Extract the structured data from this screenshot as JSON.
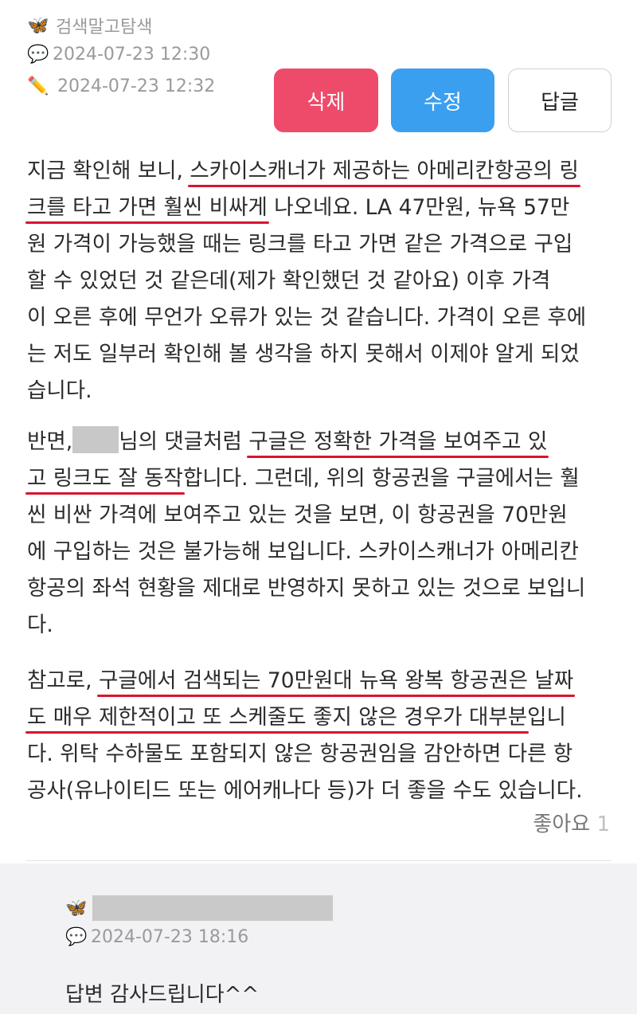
{
  "post": {
    "author_icon": "butterfly-icon",
    "author": "검색말고탐색",
    "created_icon": "speech-bubble-icon",
    "created": "2024-07-23 12:30",
    "edited_icon": "pencil-icon",
    "edited": "2024-07-23 12:32"
  },
  "actions": {
    "delete": "삭제",
    "edit": "수정",
    "reply": "답글"
  },
  "colors": {
    "delete_bg": "#ee4b6a",
    "edit_bg": "#3b9ff0",
    "underline": "#d8152d"
  },
  "body": {
    "p1_l1_a": "지금 확인해 보니, ",
    "p1_l1_b": "스카이스캐너가 제공하는 아메리칸항공의 링",
    "p1_l2_a": "크를 타고 가면 훨씬 비싸게",
    "p1_l2_b": " 나오네요. LA 47만원, 뉴욕 57만",
    "p1_l3": "원 가격이 가능했을 때는 링크를 타고 가면 같은 가격으로 구입",
    "p1_l4": "할 수 있었던 것 같은데(제가 확인했던 것 같아요) 이후 가격",
    "p1_l5": "이 오른 후에 무언가 오류가 있는 것 같습니다. 가격이 오른 후에",
    "p1_l6": "는 저도 일부러 확인해 볼 생각을 하지 못해서 이제야 알게 되었",
    "p1_l7": "습니다.",
    "p2_l1_a": "반면,",
    "p2_l1_b": "님의 댓글처럼 ",
    "p2_l1_c": "구글은 정확한 가격을 보여주고 있",
    "p2_l2_a": "고 링크도 잘 동작",
    "p2_l2_b": "합니다. 그런데, 위의 항공권을 구글에서는 훨",
    "p2_l3": "씬 비싼 가격에 보여주고 있는 것을 보면, 이 항공권을 70만원",
    "p2_l4": "에 구입하는 것은 불가능해 보입니다. 스카이스캐너가 아메리칸",
    "p2_l5": "항공의 좌석 현황을 제대로 반영하지 못하고 있는 것으로 보입니",
    "p2_l6": "다.",
    "p3_l1_a": "참고로, ",
    "p3_l1_b": "구글에서 검색되는 70만원대 뉴욕 왕복 항공권은 날짜",
    "p3_l2_a": "도 매우 제한적이고 또 스케줄도 좋지 않은 경우가 대부분",
    "p3_l2_b": "입니",
    "p3_l3": "다. 위탁 수하물도 포함되지 않은 항공권임을 감안하면 다른 항",
    "p3_l4": "공사(유나이티드 또는 에어캐나다 등)가 더 좋을 수도 있습니다."
  },
  "like": {
    "label": "좋아요",
    "count": "1"
  },
  "reply": {
    "author_icon": "butterfly-icon",
    "time_icon": "speech-bubble-icon",
    "time": "2024-07-23 18:16",
    "text": "답변 감사드립니다^^"
  }
}
